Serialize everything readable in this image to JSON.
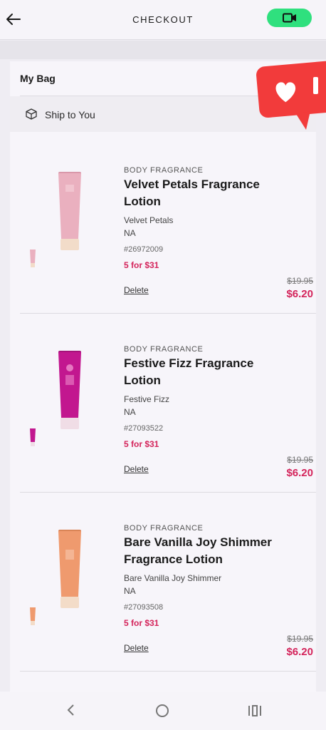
{
  "header": {
    "title": "CHECKOUT"
  },
  "bag": {
    "title": "My Bag",
    "ship_label": "Ship to You"
  },
  "items": [
    {
      "category": "BODY FRAGRANCE",
      "name": "Velvet Petals Fragrance Lotion",
      "variant": "Velvet Petals",
      "size": "NA",
      "sku": "#26972009",
      "promo": "5 for $31",
      "delete_label": "Delete",
      "original_price": "$19.95",
      "sale_price": "$6.20",
      "bottle_color": "#e8a9b8"
    },
    {
      "category": "BODY FRAGRANCE",
      "name": "Festive Fizz Fragrance Lotion",
      "variant": "Festive Fizz",
      "size": "NA",
      "sku": "#27093522",
      "promo": "5 for $31",
      "delete_label": "Delete",
      "original_price": "$19.95",
      "sale_price": "$6.20",
      "bottle_color": "#c2178f"
    },
    {
      "category": "BODY FRAGRANCE",
      "name": "Bare Vanilla Joy Shimmer Fragrance Lotion",
      "variant": "Bare Vanilla Joy Shimmer",
      "size": "NA",
      "sku": "#27093508",
      "promo": "5 for $31",
      "delete_label": "Delete",
      "original_price": "$19.95",
      "sale_price": "$6.20",
      "bottle_color": "#ef9a6e"
    }
  ],
  "colors": {
    "accent": "#d4245b",
    "video": "#2fe07e",
    "sticker": "#f23b3b"
  }
}
